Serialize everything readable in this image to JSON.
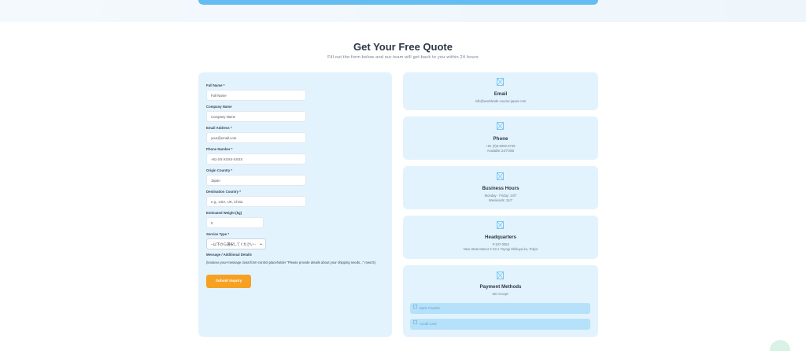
{
  "header": {
    "title": "Get Your Free Quote",
    "subtitle": "Fill out the form below and our team will get back to you within 24 hours"
  },
  "form": {
    "full_name": {
      "label": "Full Name *",
      "placeholder": "Full Name"
    },
    "company": {
      "label": "Company Name",
      "placeholder": "Company Name"
    },
    "email": {
      "label": "Email Address *",
      "placeholder": "your@email.com"
    },
    "phone": {
      "label": "Phone Number *",
      "placeholder": "+81-XX-XXXX-XXXX"
    },
    "origin": {
      "label": "Origin Country *",
      "placeholder": "Japan"
    },
    "destination": {
      "label": "Destination Country *",
      "placeholder": "e.g., USA, UK, China"
    },
    "weight": {
      "label": "Estimated Weight (kg)",
      "placeholder": "0"
    },
    "service": {
      "label": "Service Type *",
      "selected": "--以下から選択してください--"
    },
    "message": {
      "label": "Message / Additional Details",
      "note": "{textarea your-message class:form-control placeholder \"Please provide details about your shipping needs...\" rows:5}"
    },
    "submit_label": "Submit Inquiry"
  },
  "contact": {
    "email": {
      "title": "Email",
      "lines": [
        "info@worldwide-courier-japan.com"
      ]
    },
    "phone": {
      "title": "Phone",
      "lines": [
        "+81 (0)3-6000-0745",
        "Available 24/7/365"
      ]
    },
    "hours": {
      "title": "Business Hours",
      "lines": [
        "Monday - Friday: 24/7",
        "Weekends: 24/7"
      ]
    },
    "hq": {
      "title": "Headquarters",
      "lines": [
        "〒107-0052",
        "New State Manor 2-23-1 Yoyogi Shibuya-ku, Tokyo"
      ]
    },
    "payment": {
      "title": "Payment Methods",
      "line": "We Accept:",
      "methods": [
        "Bank Transfer",
        "Credit Card"
      ]
    }
  },
  "colors": {
    "card_bg": "#e3f3fd",
    "accent": "#63bdf0",
    "submit": "#f6a122"
  },
  "icons": [
    "image-placeholder-icon"
  ]
}
